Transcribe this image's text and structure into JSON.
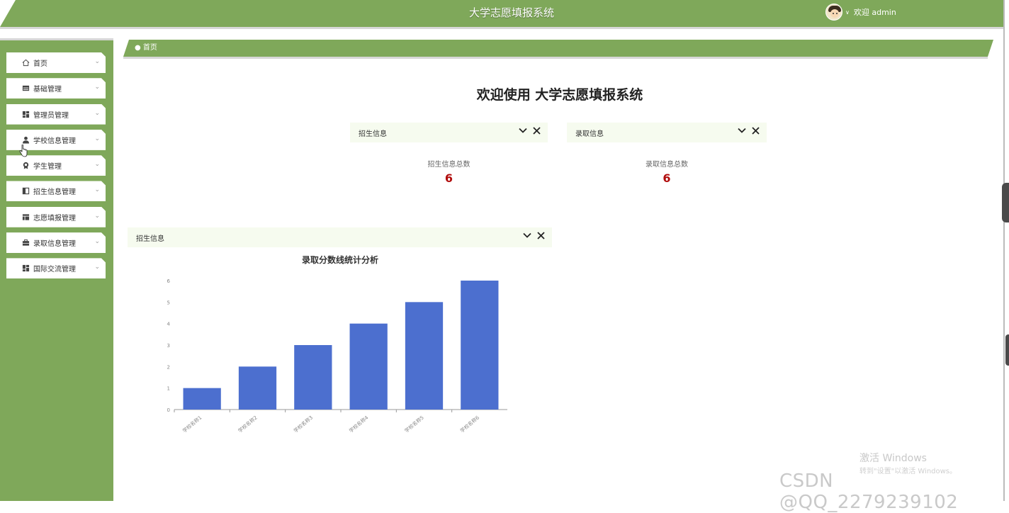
{
  "header": {
    "title": "大学志愿填报系统",
    "user_label": "欢迎 admin"
  },
  "sidebar": {
    "items": [
      {
        "label": "首页",
        "icon": "home-icon"
      },
      {
        "label": "基础管理",
        "icon": "table-icon"
      },
      {
        "label": "管理员管理",
        "icon": "dashboard-icon"
      },
      {
        "label": "学校信息管理",
        "icon": "user-icon"
      },
      {
        "label": "学生管理",
        "icon": "badge-icon"
      },
      {
        "label": "招生信息管理",
        "icon": "panel-icon"
      },
      {
        "label": "志愿填报管理",
        "icon": "layout-icon"
      },
      {
        "label": "录取信息管理",
        "icon": "briefcase-icon"
      },
      {
        "label": "国际交流管理",
        "icon": "dashboard-icon"
      }
    ]
  },
  "breadcrumb": {
    "home": "首页"
  },
  "welcome": "欢迎使用 大学志愿填报系统",
  "cards": [
    {
      "title": "招生信息",
      "stat_label": "招生信息总数",
      "stat_value": "6"
    },
    {
      "title": "录取信息",
      "stat_label": "录取信息总数",
      "stat_value": "6"
    }
  ],
  "chart_panel": {
    "title": "招生信息"
  },
  "chart_data": {
    "type": "bar",
    "title": "录取分数线统计分析",
    "categories": [
      "学校名称1",
      "学校名称2",
      "学校名称3",
      "学校名称4",
      "学校名称5",
      "学校名称6"
    ],
    "values": [
      1,
      2,
      3,
      4,
      5,
      6
    ],
    "ylim": [
      0,
      6
    ],
    "yticks": [
      0,
      1,
      2,
      3,
      4,
      5,
      6
    ],
    "xlabel": "",
    "ylabel": "",
    "grid": false,
    "bar_color": "#4c6fcf"
  },
  "watermark": {
    "line1": "激活 Windows",
    "line2": "转到\"设置\"以激活 Windows。",
    "csdn": "CSDN @QQ_2279239102"
  },
  "colors": {
    "primary": "#7fa85a",
    "stat": "#b10d0d"
  }
}
